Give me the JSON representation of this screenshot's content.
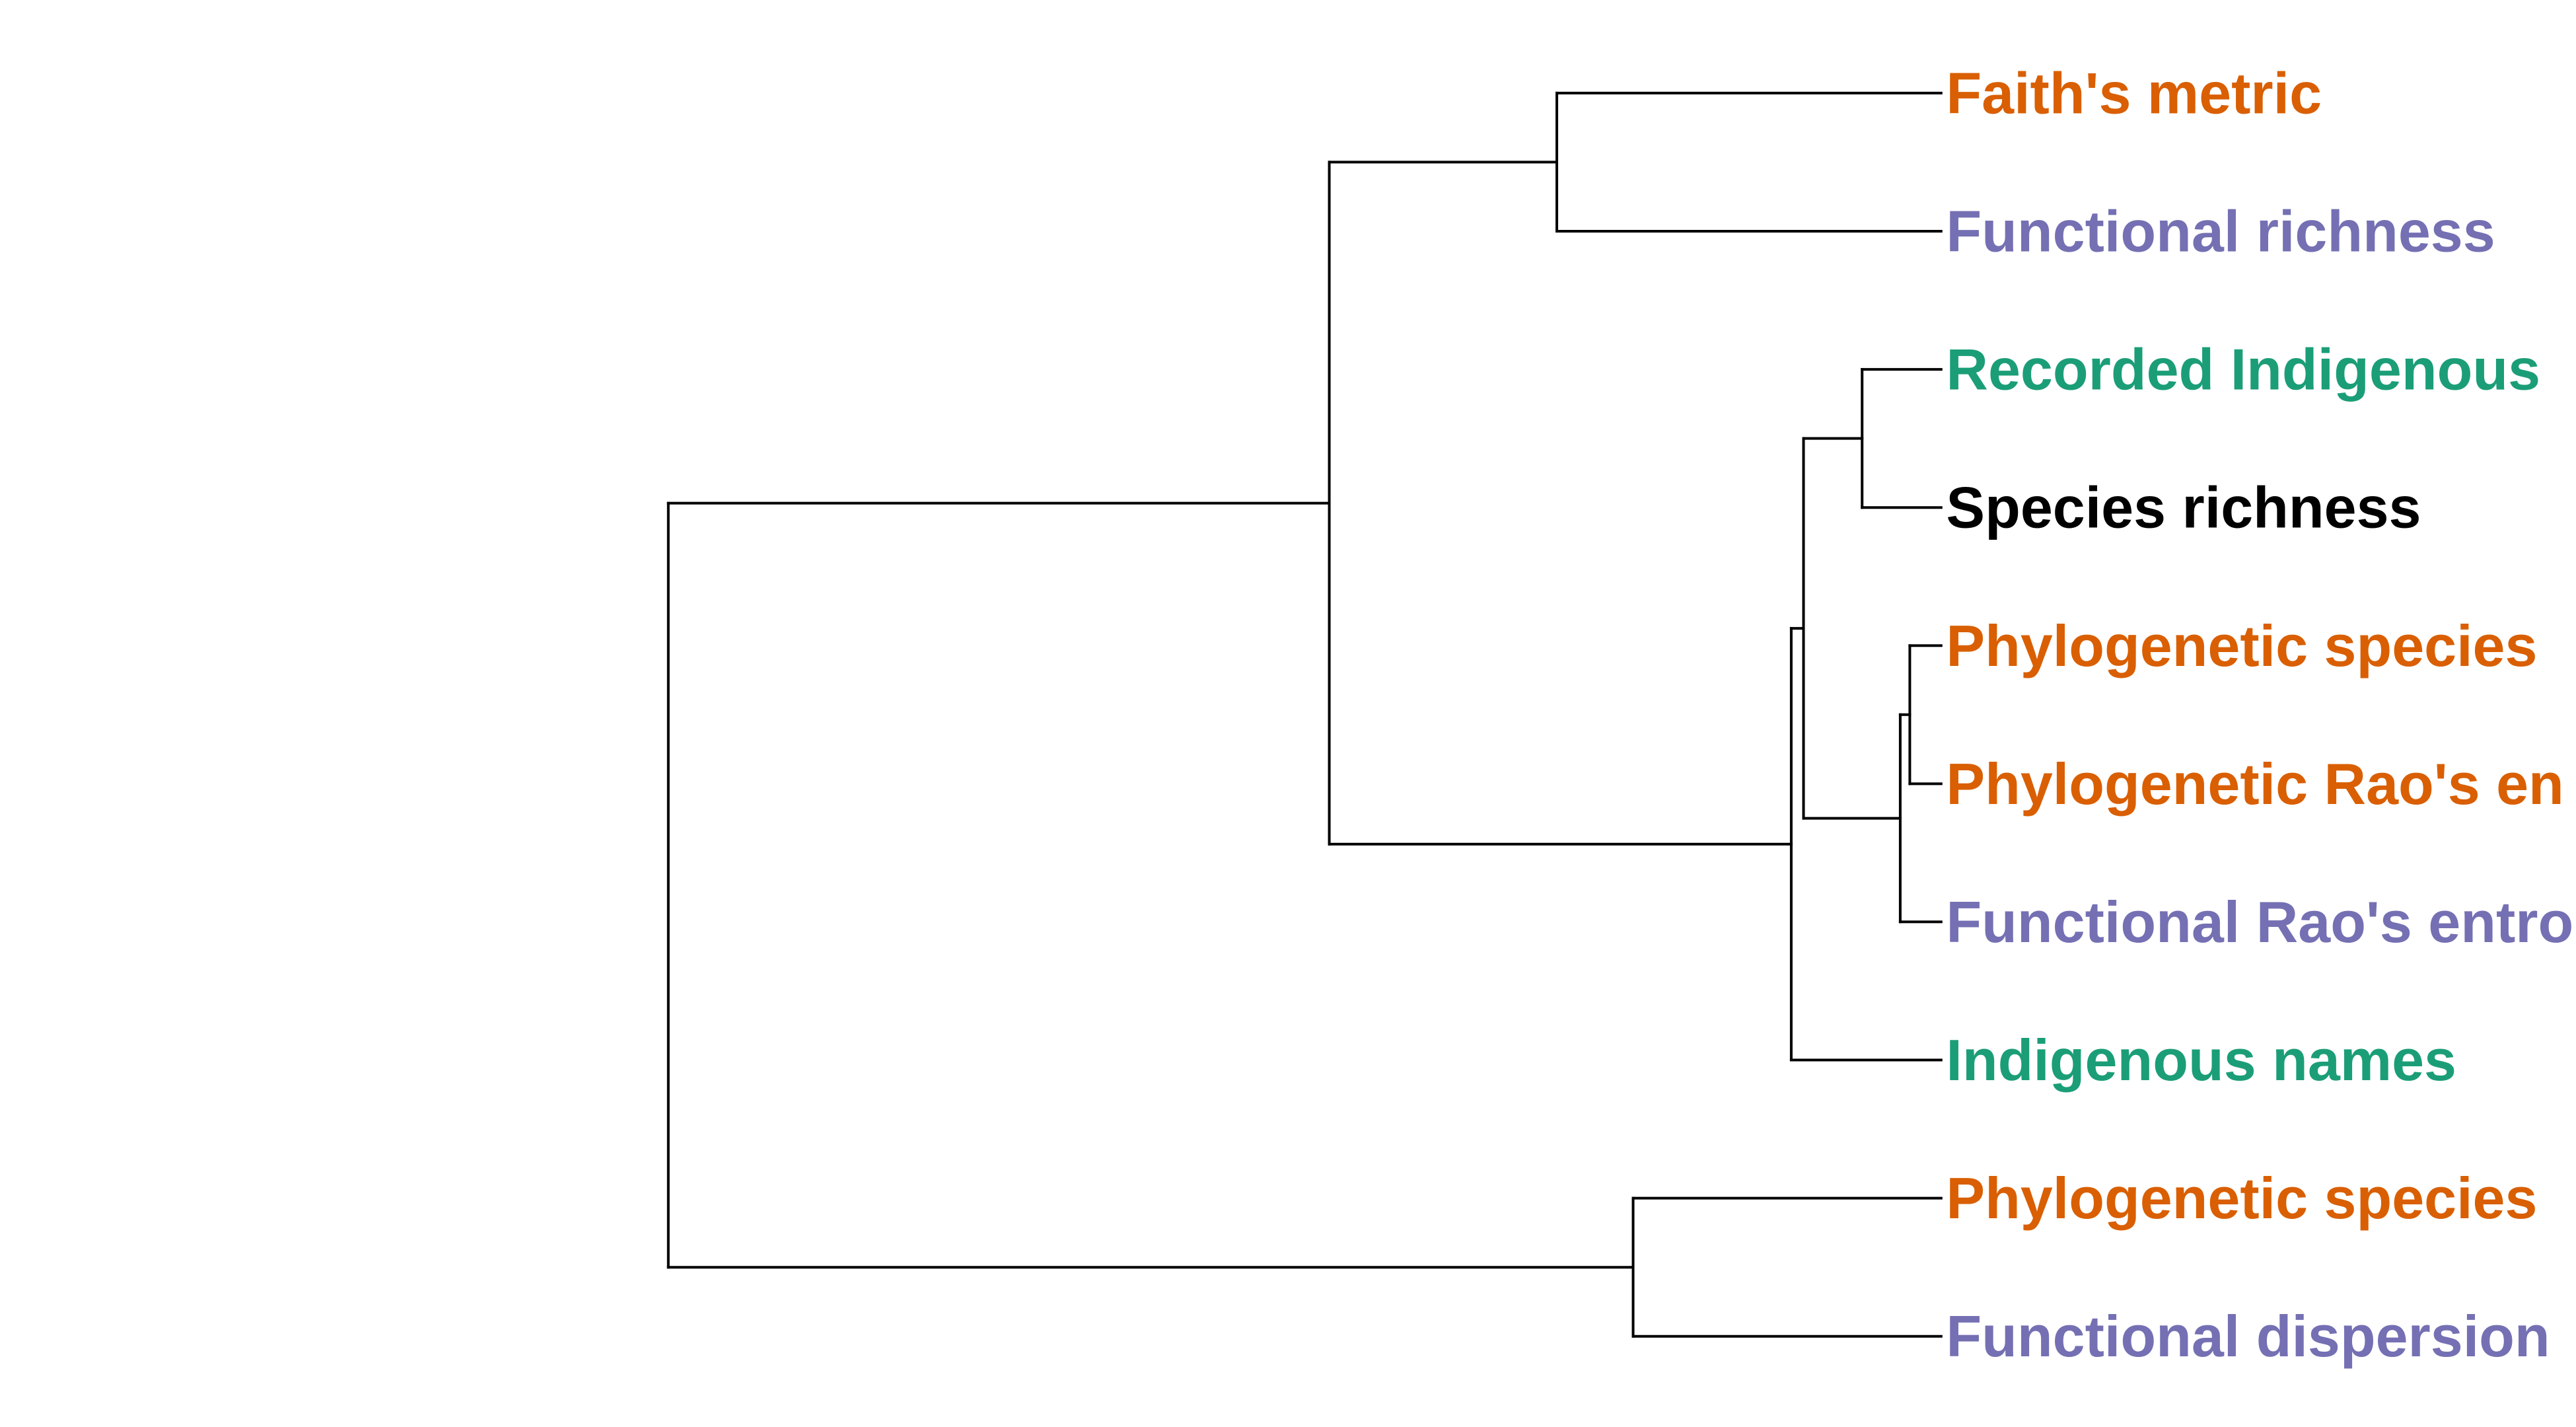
{
  "colors": {
    "phylogenetic": "#D95F02",
    "functional": "#7570B3",
    "indigenous": "#1B9E77",
    "taxonomic": "#000000",
    "branch": "#000000"
  },
  "leaves": [
    {
      "label": "Faith's metric",
      "group": "phylogenetic"
    },
    {
      "label": "Functional richness",
      "group": "functional"
    },
    {
      "label": "Recorded Indigenous",
      "group": "indigenous"
    },
    {
      "label": "Species richness",
      "group": "taxonomic"
    },
    {
      "label": "Phylogenetic species",
      "group": "phylogenetic"
    },
    {
      "label": "Phylogenetic Rao's en",
      "group": "phylogenetic"
    },
    {
      "label": "Functional Rao's entro",
      "group": "functional"
    },
    {
      "label": "Indigenous names",
      "group": "indigenous"
    },
    {
      "label": "Phylogenetic species",
      "group": "phylogenetic"
    },
    {
      "label": "Functional dispersion",
      "group": "functional"
    }
  ],
  "merges": [
    {
      "id": "a",
      "children": [
        "L4",
        "L5"
      ],
      "height": 0.023
    },
    {
      "id": "b",
      "children": [
        "a",
        "L6"
      ],
      "height": 0.03
    },
    {
      "id": "c",
      "children": [
        "L2",
        "L3"
      ],
      "height": 0.058
    },
    {
      "id": "d",
      "children": [
        "c",
        "b"
      ],
      "height": 0.101
    },
    {
      "id": "e",
      "children": [
        "d",
        "L7"
      ],
      "height": 0.11
    },
    {
      "id": "f",
      "children": [
        "L8",
        "L9"
      ],
      "height": 0.226
    },
    {
      "id": "g",
      "children": [
        "L0",
        "L1"
      ],
      "height": 0.282
    },
    {
      "id": "h",
      "children": [
        "g",
        "e"
      ],
      "height": 0.449
    },
    {
      "id": "root",
      "children": [
        "h",
        "f"
      ],
      "height": 0.934
    }
  ]
}
